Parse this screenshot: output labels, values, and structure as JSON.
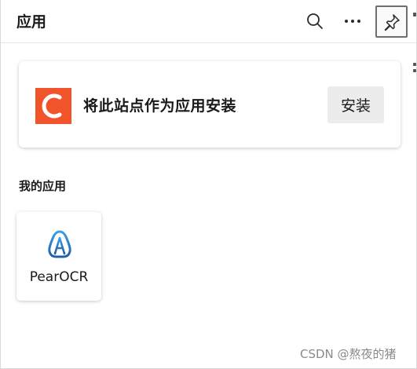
{
  "header": {
    "title": "应用",
    "search_icon": "search-icon",
    "more_icon": "more-options-icon",
    "pin_icon": "pin-icon"
  },
  "install_card": {
    "text": "将此站点作为应用安装",
    "button_label": "安装",
    "logo_letter": "C",
    "logo_color": "#f1542a"
  },
  "my_apps": {
    "title": "我的应用",
    "apps": [
      {
        "label": "PearOCR",
        "icon": "pearocr-icon"
      }
    ]
  },
  "watermark": "CSDN @熬夜的猪"
}
